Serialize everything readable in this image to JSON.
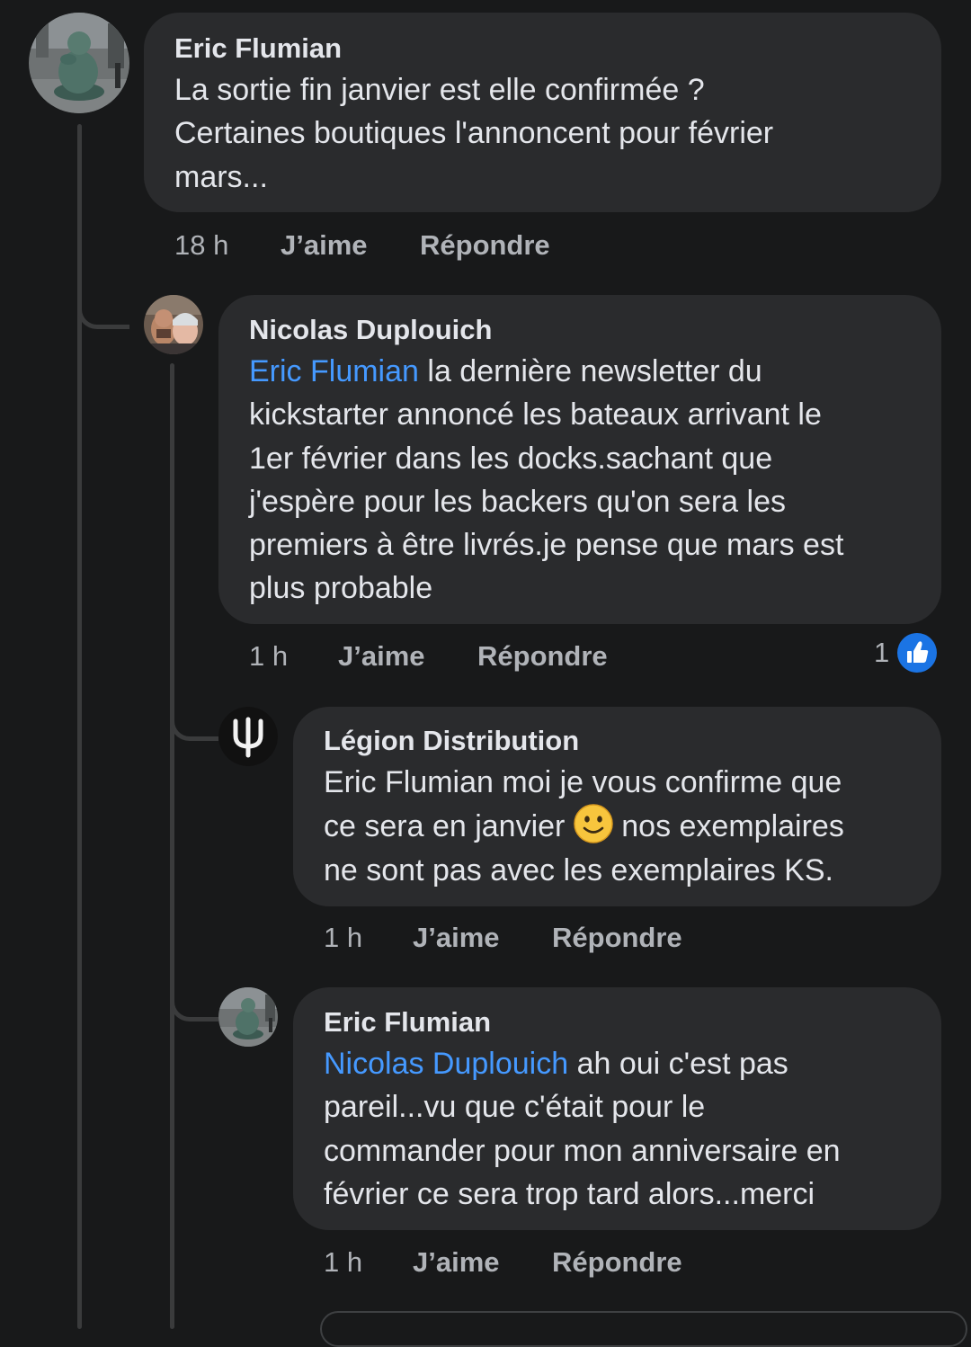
{
  "comments": [
    {
      "author": "Eric Flumian",
      "lines": [
        "La sortie fin janvier est elle confirmée ?",
        "Certaines boutiques l'annoncent pour février",
        "mars..."
      ],
      "time": "18 h",
      "like_label": "J’aime",
      "reply_label": "Répondre"
    },
    {
      "author": "Nicolas Duplouich",
      "mention": "Eric Flumian",
      "lines": [
        " la dernière newsletter du",
        "kickstarter annoncé les bateaux arrivant le",
        "1er février dans les docks.sachant que",
        "j'espère pour les backers qu'on sera les",
        "premiers à être livrés.je pense que mars est",
        "plus probable"
      ],
      "time": "1 h",
      "like_label": "J’aime",
      "reply_label": "Répondre",
      "reaction_count": "1",
      "reaction_icon": "thumbs-up-icon"
    },
    {
      "author": "Légion Distribution",
      "lines": [
        "Eric Flumian moi je vous confirme que",
        "ce sera en janvier ",
        " nos exemplaires",
        "ne sont pas avec les exemplaires KS."
      ],
      "emoji": "slightly-smiling-face-icon",
      "time": "1 h",
      "like_label": "J’aime",
      "reply_label": "Répondre"
    },
    {
      "author": "Eric Flumian",
      "mention": "Nicolas Duplouich",
      "lines": [
        " ah oui c'est pas",
        "pareil...vu que c'était pour le",
        "commander pour mon anniversaire en",
        "février ce sera trop tard alors...merci"
      ],
      "time": "1 h",
      "like_label": "J’aime",
      "reply_label": "Répondre"
    }
  ],
  "colors": {
    "background": "#18191a",
    "bubble": "#2a2b2d",
    "text": "#e4e6eb",
    "secondary_text": "#b0b3b8",
    "mention": "#4599ff",
    "like_badge": "#1b74e4",
    "thread_line": "#3a3b3c"
  }
}
